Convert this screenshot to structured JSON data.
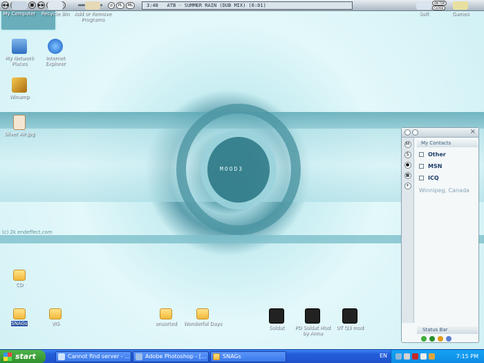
{
  "winamp": {
    "buttons": [
      "◀◀",
      "▶",
      "❚❚",
      "■",
      "▶▶",
      "⏏"
    ],
    "vol_label": "◐",
    "small_buttons": [
      "◎",
      "PL",
      "ML"
    ],
    "time": "3:48",
    "track": "ATB - SUMMER RAIN (DUB MIX) (6:01)",
    "ontop": "ON TOP",
    "close": "CLOSE"
  },
  "desktop_icons": [
    {
      "label": "My Computer"
    },
    {
      "label": "Recycle Bin"
    },
    {
      "label": "Add or Remove Programs"
    },
    {
      "label": "Soft"
    },
    {
      "label": "Games"
    },
    {
      "label": "My Network Places"
    },
    {
      "label": "Internet Explorer"
    },
    {
      "label": "Winamp"
    },
    {
      "label": "Silver Air.jpg"
    },
    {
      "label": "CD"
    },
    {
      "label": "SNAGs"
    },
    {
      "label": "VIS"
    },
    {
      "label": "unsorted"
    },
    {
      "label": "Wonderful Days"
    },
    {
      "label": "Soldat"
    },
    {
      "label": "PD Soldat Mod by Anna"
    },
    {
      "label": "UT Q3 mod"
    }
  ],
  "wallpaper": {
    "credit": "(c) 2k endeffect.com",
    "center_text": "MOOD3"
  },
  "messenger": {
    "header": "My Contacts",
    "groups": [
      "Other",
      "MSN",
      "ICQ"
    ],
    "location": "Winnipeg, Canada",
    "status_bar": "Status Bar",
    "side_buttons": [
      "M",
      "S",
      "●",
      "▦",
      "+"
    ]
  },
  "taskbar": {
    "start": "start",
    "tasks": [
      "Cannot find server - ...",
      "Adobe Photoshop - [...",
      "SNAGs"
    ],
    "language": "EN",
    "clock": "7:15 PM"
  },
  "colors": {
    "accent": "#245edb",
    "start_green": "#2f8f2c",
    "tray": "#0e8ae4"
  }
}
